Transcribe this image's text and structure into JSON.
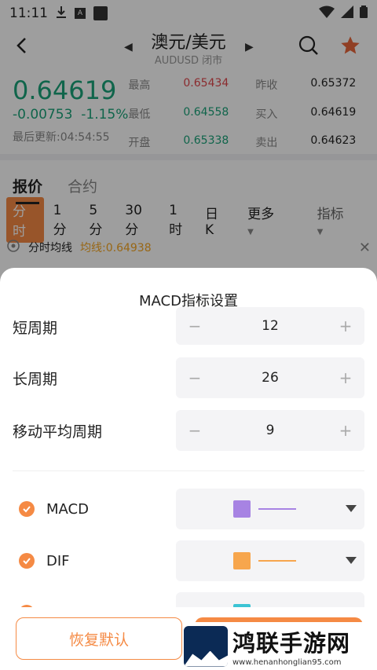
{
  "status": {
    "time": "11:11",
    "a_icon": "A"
  },
  "nav": {
    "title": "澳元/美元",
    "subtitle": "AUDUSD 闭市"
  },
  "quote": {
    "price": "0.64619",
    "change": "-0.00753",
    "change_pct": "-1.15%",
    "updated": "最后更新:04:54:55",
    "cells": [
      {
        "label": "最高",
        "value": "0.65434",
        "color": "red"
      },
      {
        "label": "昨收",
        "value": "0.65372",
        "color": "black"
      },
      {
        "label": "最低",
        "value": "0.64558",
        "color": "green"
      },
      {
        "label": "买入",
        "value": "0.64619",
        "color": "black"
      },
      {
        "label": "开盘",
        "value": "0.65338",
        "color": "green"
      },
      {
        "label": "卖出",
        "value": "0.64623",
        "color": "black"
      }
    ]
  },
  "tabs": {
    "quote": "报价",
    "contract": "合约"
  },
  "periods": {
    "p0": "分时",
    "p1": "1分",
    "p2": "5分",
    "p3": "30分",
    "p4": "1时",
    "p5": "日K",
    "more": "更多",
    "indicator": "指标"
  },
  "lineinfo": {
    "label": "分时均线",
    "ma": "均线:0.64938"
  },
  "sheet": {
    "title": "MACD指标设置",
    "params": [
      {
        "label": "短周期",
        "value": "12"
      },
      {
        "label": "长周期",
        "value": "26"
      },
      {
        "label": "移动平均周期",
        "value": "9"
      }
    ],
    "lines": [
      {
        "label": "MACD",
        "color": "#a783e3"
      },
      {
        "label": "DIF",
        "color": "#f7a64d"
      },
      {
        "label": "",
        "color": "#3cc4d4"
      }
    ],
    "reset": "恢复默认"
  },
  "watermark": {
    "title": "鸿联手游网",
    "url": "www.henanhonglian95.com"
  },
  "colors": {
    "accent": "#f58a44",
    "up": "#e0474c",
    "down": "#1aa37a"
  }
}
